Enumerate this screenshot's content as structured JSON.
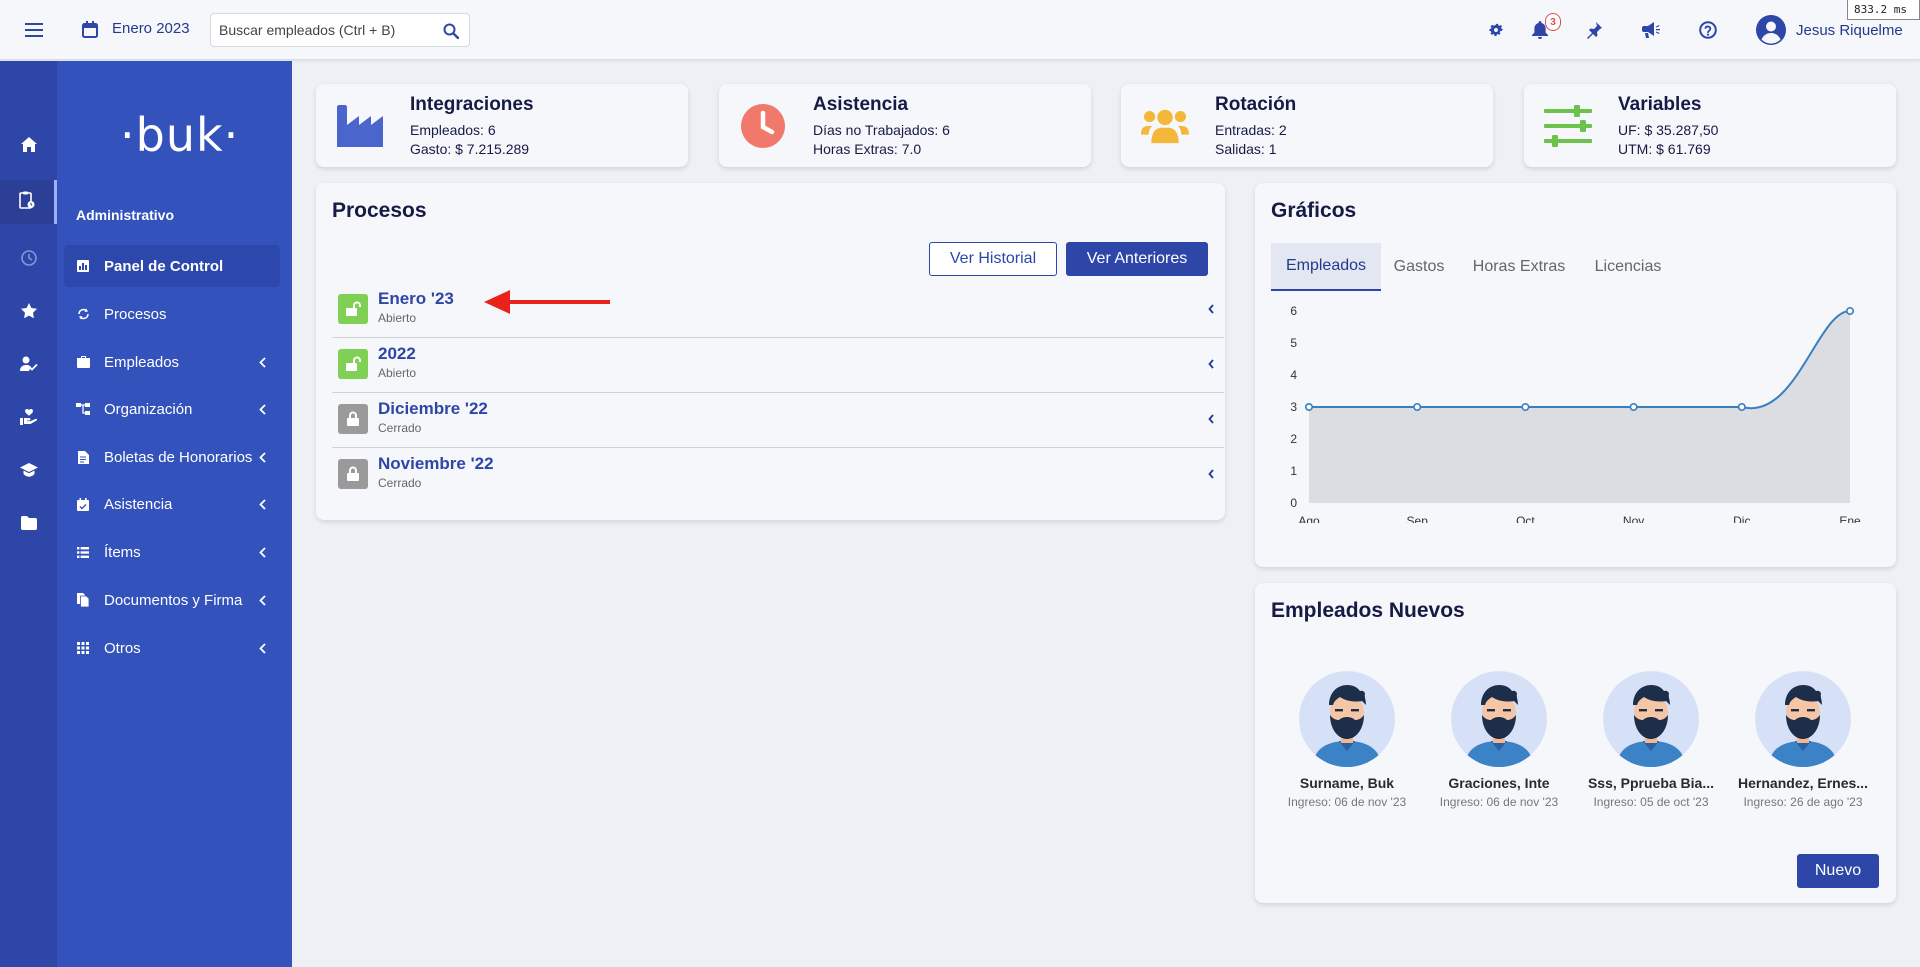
{
  "topbar": {
    "month": "Enero 2023",
    "search_placeholder": "Buscar empleados (Ctrl + B)",
    "notifications_count": "3",
    "user_name": "Jesus Riquelme",
    "perf": "833.2 ms"
  },
  "sidebar": {
    "logo": "·buk·",
    "heading": "Administrativo",
    "items": [
      {
        "label": "Panel de Control",
        "icon": "dashboard-icon",
        "active": true,
        "chevron": false
      },
      {
        "label": "Procesos",
        "icon": "refresh-icon",
        "chevron": false
      },
      {
        "label": "Empleados",
        "icon": "briefcase-icon",
        "chevron": true
      },
      {
        "label": "Organización",
        "icon": "sitemap-icon",
        "chevron": true
      },
      {
        "label": "Boletas de Honorarios",
        "icon": "file-invoice-icon",
        "chevron": true
      },
      {
        "label": "Asistencia",
        "icon": "calendar-check-icon",
        "chevron": true
      },
      {
        "label": "Ítems",
        "icon": "list-icon",
        "chevron": true
      },
      {
        "label": "Documentos y Firma",
        "icon": "documents-icon",
        "chevron": true
      },
      {
        "label": "Otros",
        "icon": "grid-icon",
        "chevron": true
      }
    ],
    "rail_icons": [
      "home-icon",
      "clipboard-icon",
      "clock-icon",
      "star-icon",
      "user-check-icon",
      "hand-heart-icon",
      "graduation-cap-icon",
      "folder-icon"
    ]
  },
  "stats": [
    {
      "title": "Integraciones",
      "line1": "Empleados: 6",
      "line2": "Gasto: $ 7.215.289",
      "icon": "factory-icon",
      "color": "#4a66cc"
    },
    {
      "title": "Asistencia",
      "line1": "Días no Trabajados: 6",
      "line2": "Horas Extras: 7.0",
      "icon": "clock-icon",
      "color": "#f0796c"
    },
    {
      "title": "Rotación",
      "line1": "Entradas: 2",
      "line2": "Salidas: 1",
      "icon": "users-icon",
      "color": "#f4b73a"
    },
    {
      "title": "Variables",
      "line1": "UF: $ 35.287,50",
      "line2": "UTM: $ 61.769",
      "icon": "sliders-icon",
      "color": "#6cc24a"
    }
  ],
  "procesos": {
    "title": "Procesos",
    "btn_historial": "Ver Historial",
    "btn_anteriores": "Ver Anteriores",
    "rows": [
      {
        "name": "Enero '23",
        "status": "Abierto",
        "open": true
      },
      {
        "name": "2022",
        "status": "Abierto",
        "open": true
      },
      {
        "name": "Diciembre '22",
        "status": "Cerrado",
        "open": false
      },
      {
        "name": "Noviembre '22",
        "status": "Cerrado",
        "open": false
      }
    ]
  },
  "graficos": {
    "title": "Gráficos",
    "tabs": [
      "Empleados",
      "Gastos",
      "Horas Extras",
      "Licencias"
    ],
    "active_tab": 0
  },
  "chart_data": {
    "type": "area",
    "categories": [
      "Ago",
      "Sep",
      "Oct",
      "Nov",
      "Dic",
      "Ene"
    ],
    "values": [
      3,
      3,
      3,
      3,
      3,
      6
    ],
    "ylim": [
      0,
      6
    ],
    "yticks": [
      "0",
      "1",
      "2",
      "3",
      "4",
      "5",
      "6"
    ],
    "grid": false,
    "line_color": "#3a7fc1",
    "fill_color": "#dcdde2"
  },
  "nuevos": {
    "title": "Empleados Nuevos",
    "employees": [
      {
        "name": "Surname, Buk",
        "date": "Ingreso: 06 de nov '23"
      },
      {
        "name": "Graciones, Inte",
        "date": "Ingreso: 06 de nov '23"
      },
      {
        "name": "Sss, Pprueba Bia...",
        "date": "Ingreso: 05 de oct '23"
      },
      {
        "name": "Hernandez, Ernes...",
        "date": "Ingreso: 26 de ago '23"
      }
    ],
    "btn_nuevo": "Nuevo"
  }
}
